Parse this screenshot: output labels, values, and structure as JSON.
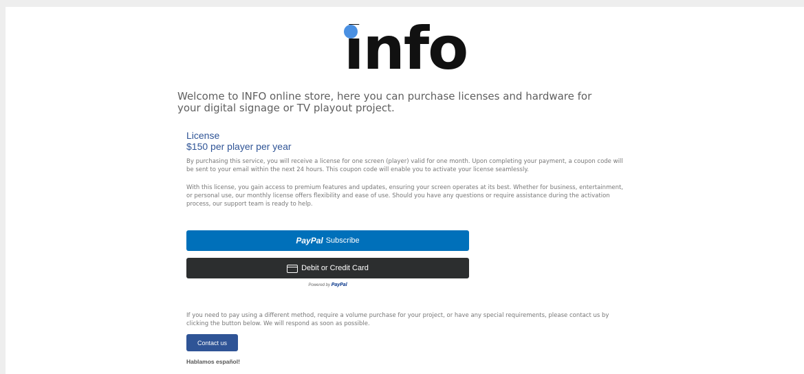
{
  "logo": {
    "text": "info",
    "dot_color": "#4a90e2"
  },
  "welcome_text": "Welcome to INFO online store, here you can purchase licenses and hardware for your digital signage or TV playout project.",
  "license": {
    "title": "License",
    "price": "$150 per player per year",
    "color": "#2f5496"
  },
  "paragraphs": {
    "p1": "By purchasing this service, you will receive a license for one screen (player) valid for one month. Upon completing your payment, a coupon code will be sent to your email within the next 24 hours. This coupon code will enable you to activate your license seamlessly.",
    "p2": "With this license, you gain access to premium features and updates, ensuring your screen operates at its best. Whether for business, entertainment, or personal use, our monthly license offers flexibility and ease of use. Should you have any questions or require assistance during the activation process, our support team is ready to help.",
    "p3": "If you need to pay using a different method, require a volume purchase for your project, or have any special requirements, please contact us by clicking the button below. We will respond as soon as possible."
  },
  "paypal_button": {
    "brand": "PayPal",
    "action": "Subscribe",
    "bg_color": "#0070ba",
    "icon": "paypal-logo"
  },
  "card_button": {
    "label": "Debit or Credit Card",
    "bg_color": "#2c2e2f",
    "icon": "credit-card-icon"
  },
  "powered_by": {
    "text": "Powered by",
    "brand": "PayPal",
    "brand_color": "#003087"
  },
  "contact_button": {
    "label": "Contact us",
    "bg_color": "#2f5496"
  },
  "spanish_note": "Hablamos español!"
}
